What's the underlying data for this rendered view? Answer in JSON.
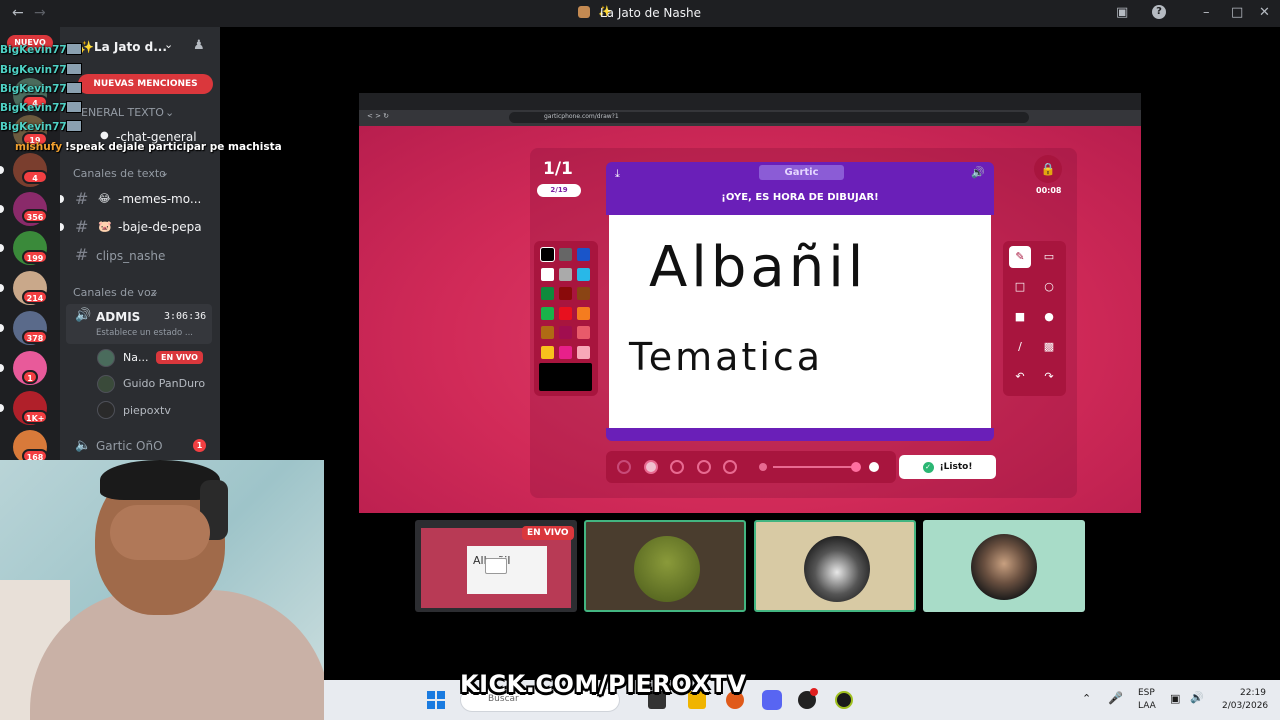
{
  "window": {
    "title": "La Jato de Nashe"
  },
  "server": {
    "name": "La Jato d...",
    "new_badge": "NUEVO",
    "mentions_banner": "NUEVAS MENCIONES",
    "category_text_top": "ENERAL TEXTO",
    "chat_general": "-chat-general",
    "category_text": "Canales de texto",
    "channels": [
      "-memes-mo...",
      "-baje-de-pepa",
      "clips_nashe"
    ],
    "category_voice": "Canales de voz",
    "voice_channel": {
      "name": "ADMIS",
      "timer": "3:06:36",
      "status": "Establece un estado ..."
    },
    "voice_users": [
      {
        "name": "Na...",
        "live": "EN VIVO"
      },
      {
        "name": "Guido PanDuro"
      },
      {
        "name": "piероxtv"
      }
    ],
    "gartic_channel": {
      "name": "Gartic OñO",
      "badge": "1"
    }
  },
  "rail_badges": [
    "4",
    "19",
    "4",
    "356",
    "199",
    "214",
    "378",
    "1",
    "1K+",
    "168"
  ],
  "chat_overlay": {
    "lines": [
      {
        "name": "BigKevin77"
      },
      {
        "name": "BigKevin77"
      },
      {
        "name": "BigKevin77"
      },
      {
        "name": "BigKevin77"
      },
      {
        "name": "BigKevin77"
      }
    ],
    "last": {
      "name": "mishufy",
      "message": "!speak dejale participar pe machista"
    }
  },
  "browser": {
    "url": "garticphone.com/draw?1"
  },
  "gartic": {
    "round": "1/1",
    "players": "2/19",
    "logo": "Gartic",
    "headline": "¡OYE, ES HORA DE DIBUJAR!",
    "drawing_line1": "Albañil",
    "drawing_line2": "Tematica",
    "timer": "00:08",
    "done_button": "¡Listo!",
    "palette": [
      "#000000",
      "#666666",
      "#1a55c9",
      "#ffffff",
      "#aaaaaa",
      "#28b8e8",
      "#0f8a3c",
      "#8a0a0a",
      "#8a4414",
      "#19b34a",
      "#e8101e",
      "#f57c1f",
      "#b06a14",
      "#a10e4f",
      "#e85a6a",
      "#f8c21c",
      "#e8208a",
      "#f8a8b8"
    ],
    "colors": {
      "board": "#a8153e",
      "header": "#6a1fb8",
      "bg": "#d52b5a"
    }
  },
  "tiles": [
    {
      "label": "EN VIVO",
      "bg": "#2c2d31",
      "tag": "Albañil"
    },
    {
      "bg": "#4a3d2e",
      "border": "#43b581"
    },
    {
      "bg": "#d8caa4",
      "border": "#43b581"
    },
    {
      "bg": "#a8dcc8"
    }
  ],
  "overlay_brand": "KICK.COM/PIEROXTV",
  "taskbar": {
    "search_placeholder": "Buscar",
    "lang1": "ESP",
    "lang2": "LAA",
    "time": "22:19",
    "date": "2/03/2026"
  }
}
